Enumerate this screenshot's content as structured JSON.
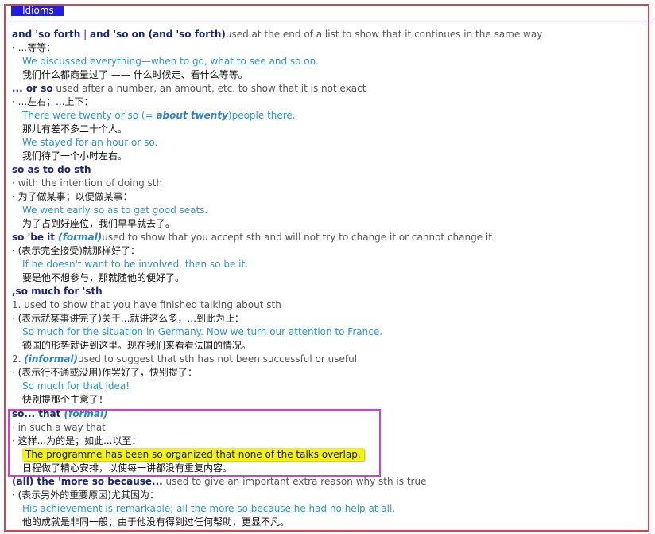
{
  "header": {
    "top_fragment": "·····",
    "section_label": "Idioms"
  },
  "colors": {
    "headword": "#1a237e",
    "example": "#2f95d0",
    "register_tag": "#2a7fd4",
    "highlight": "#f2f218",
    "frame_red": "#d9434f",
    "frame_magenta": "#d63cd8"
  },
  "entries": {
    "e1": {
      "hw1": "and 'so forth",
      "sep": " | ",
      "hw2": "and 'so on (and 'so forth)",
      "def": "used at the end of a list to show that it continues in the same way",
      "zh": "· ...等等：",
      "ex": "We discussed everything—when to go, what to see and so on.",
      "exzh": "我们什么都商量过了 —— 什么时候走、看什么等等。"
    },
    "e2": {
      "hw": "... or so",
      "def": " used after a number, an amount, etc. to show that it is not exact",
      "zh": "· ...左右；...上下：",
      "ex1_a": "There were twenty or so (= ",
      "ex1_b": "about twenty",
      "ex1_c": ")people there.",
      "exzh1": "那儿有差不多二十个人。",
      "ex2": "We stayed for an hour or so.",
      "exzh2": "我们待了一个小时左右。"
    },
    "e3": {
      "hw": "so as to do sth",
      "def": "· with the intention of doing sth",
      "zh": "· 为了做某事；以便做某事：",
      "ex": "We went early so as to get good seats.",
      "exzh": "为了占到好座位，我们早早就去了。"
    },
    "e4": {
      "hw": "so 'be it",
      "tag": " (formal)",
      "def": "used to show that you accept sth and will not try to change it or cannot change it",
      "zh": "· (表示完全接受)就那样好了：",
      "ex": "If he doesn't want to be involved, then so be it.",
      "exzh": "要是他不想参与，那就随他的便好了。"
    },
    "e5": {
      "hw": ",so much for 'sth",
      "def1": "1. used to show that you have finished talking about sth",
      "zh1": "· (表示就某事讲完了)关于...就讲这么多，...到此为止：",
      "ex1": "So much for the situation in Germany. Now we turn our attention to France.",
      "exzh1": "德国的形势就讲到这里。现在我们来看看法国的情况。",
      "num2": "2. ",
      "tag2": "(informal)",
      "def2": "used to suggest that sth has not been successful or useful",
      "zh2": "· (表示行不通或没用)作罢好了，快别提了：",
      "ex2": "So much for that idea!",
      "exzh2": "快别提那个主意了！"
    },
    "e6": {
      "hw": "so... that",
      "tag": " (formal)",
      "def": "· in such a way that",
      "zh": "· 这样...为的是；如此...以至：",
      "ex": "The programme has been so organized that none of the talks overlap.",
      "exzh": "日程做了精心安排，以使每一讲都没有重复内容。"
    },
    "e7": {
      "hw": "(all) the 'more so because...",
      "def": " used to give an important extra reason why sth is true",
      "zh": "· (表示另外的重要原因)尤其因为：",
      "ex": "His achievement is remarkable; all the more so because he had no help at all.",
      "exzh": "他的成就是非同一般；由于他没有得到过任何帮助，更显不凡。"
    }
  }
}
